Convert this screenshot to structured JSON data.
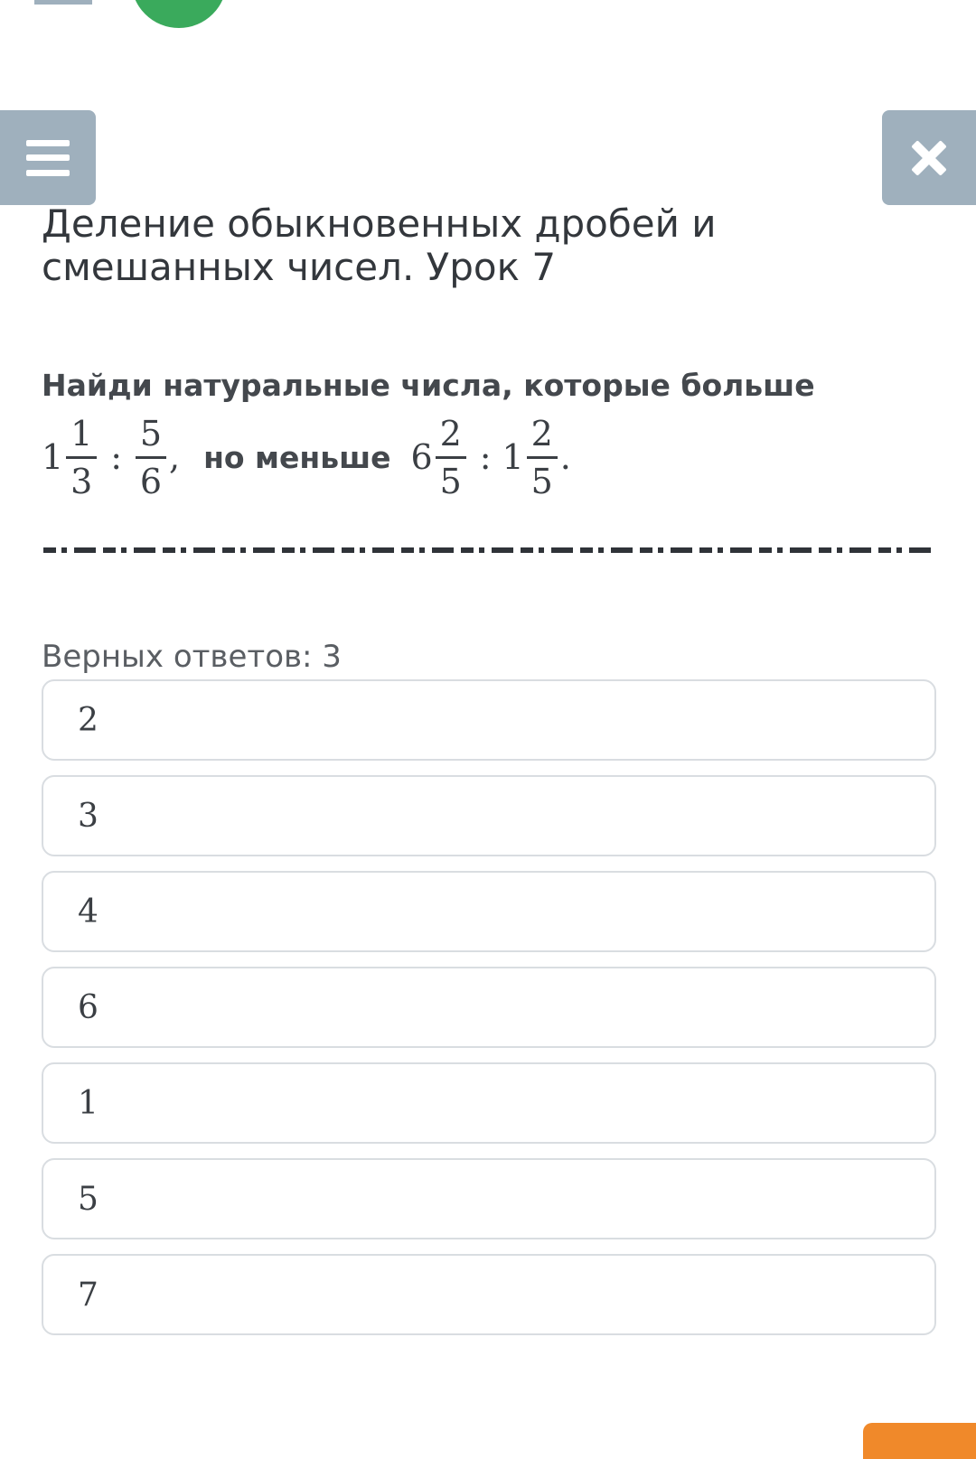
{
  "colors": {
    "avatar": "#3aaa5c",
    "header_button": "#9fb0bd",
    "option_border": "#d9dde1",
    "next_button": "#f0892a",
    "text": "#3b3f44"
  },
  "header": {
    "menu_icon": "hamburger-menu-icon",
    "close_icon": "close-x-icon"
  },
  "lesson": {
    "title": "Деление обыкновенных дробей и смешанных чисел. Урок 7"
  },
  "question": {
    "line1": "Найди натуральные числа, которые больше",
    "expr1": {
      "whole": "1",
      "frac1_num": "1",
      "frac1_den": "3",
      "operator": ":",
      "frac2_num": "5",
      "frac2_den": "6",
      "punct": ","
    },
    "middle_word": "но меньше",
    "expr2": {
      "whole1": "6",
      "frac1_num": "2",
      "frac1_den": "5",
      "operator": ":",
      "whole2": "1",
      "frac2_num": "2",
      "frac2_den": "5",
      "punct": "."
    }
  },
  "answers": {
    "count_label": "Верных ответов: 3",
    "options": [
      "2",
      "3",
      "4",
      "6",
      "1",
      "5",
      "7"
    ]
  }
}
